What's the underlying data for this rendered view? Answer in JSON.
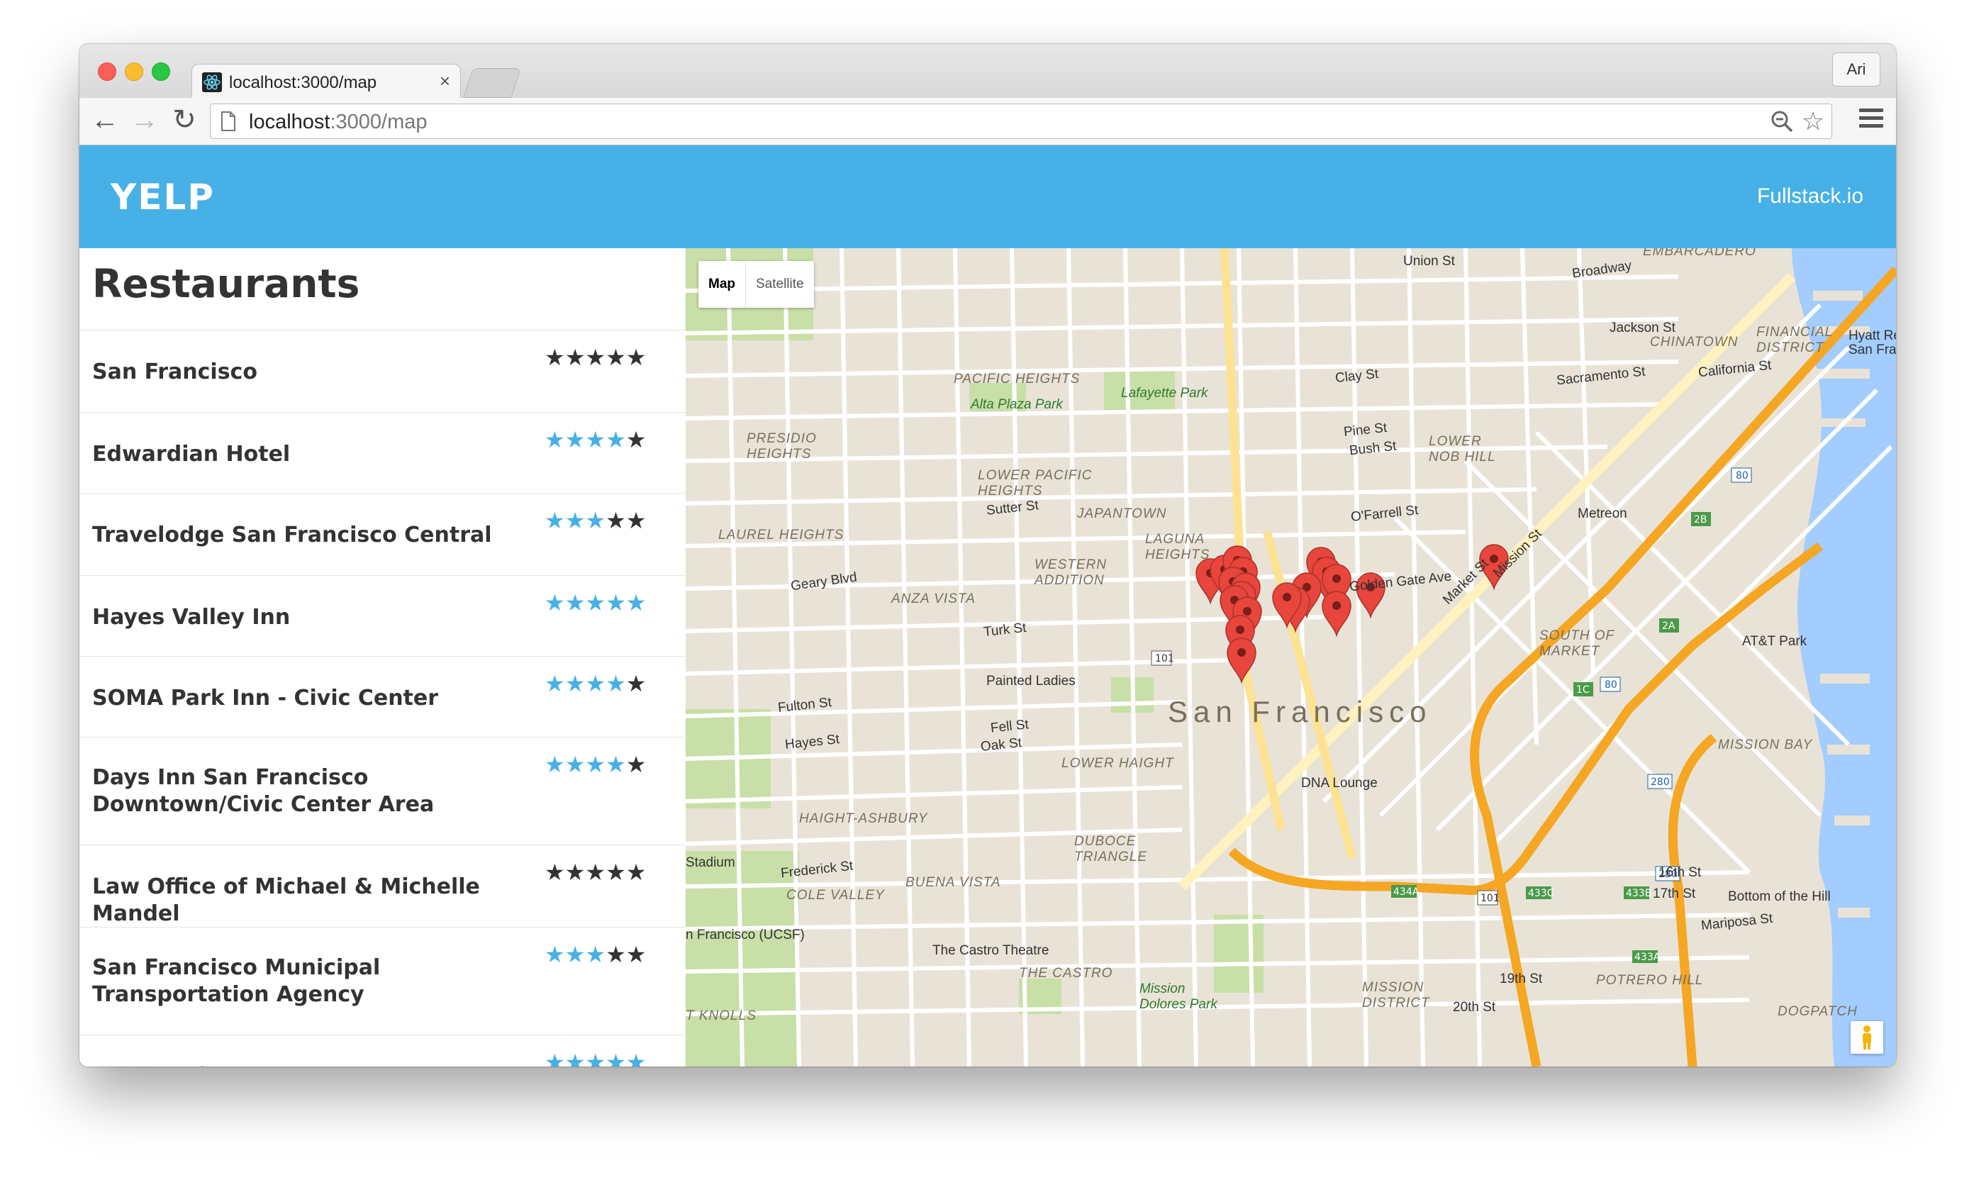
{
  "browser": {
    "tab_title": "localhost:3000/map",
    "tab_close": "×",
    "profile_label": "Ari",
    "url_host": "localhost",
    "url_path": ":3000/map",
    "back_glyph": "←",
    "forward_glyph": "→",
    "reload_glyph": "↻",
    "star_glyph": "☆"
  },
  "app": {
    "logo": "YELP",
    "brand_link": "Fullstack.io",
    "sidebar_title": "Restaurants"
  },
  "restaurants": [
    {
      "name": "San Francisco",
      "rating": 0
    },
    {
      "name": "Edwardian Hotel",
      "rating": 4
    },
    {
      "name": "Travelodge San Francisco Central",
      "rating": 3
    },
    {
      "name": "Hayes Valley Inn",
      "rating": 5
    },
    {
      "name": "SOMA Park Inn - Civic Center",
      "rating": 4
    },
    {
      "name": "Days Inn San Francisco Downtown/Civic Center Area",
      "rating": 4
    },
    {
      "name": "Law Office of Michael & Michelle Mandel",
      "rating": 0
    },
    {
      "name": "San Francisco Municipal Transportation Agency",
      "rating": 3
    },
    {
      "name": "Zuni Café",
      "rating": 5
    }
  ],
  "map": {
    "map_type_map": "Map",
    "map_type_satellite": "Satellite",
    "city_label": "San Francisco",
    "labels": {
      "union_st": "Union St",
      "jackson_st": "Jackson St",
      "chinatown": "CHINATOWN",
      "financial_district": "FINANCIAL DISTRICT",
      "hyatt": "Hyatt Regency San Francisco",
      "pacific_heights": "PACIFIC HEIGHTS",
      "alta_plaza": "Alta Plaza Park",
      "lafayette": "Lafayette Park",
      "presidio_heights": "PRESIDIO HEIGHTS",
      "lower_pacific": "LOWER PACIFIC HEIGHTS",
      "japantown": "JAPANTOWN",
      "laurel_heights": "LAUREL HEIGHTS",
      "western_addition": "WESTERN ADDITION",
      "laguna_heights": "LAGUNA HEIGHTS",
      "anza_vista": "ANZA VISTA",
      "lower_nob_hill": "LOWER NOB HILL",
      "metreon": "Metreon",
      "south_of_market": "SOUTH OF MARKET",
      "att_park": "AT&T Park",
      "painted_ladies": "Painted Ladies",
      "mission_bay": "MISSION BAY",
      "lower_haight": "LOWER HAIGHT",
      "haight_ashbury": "HAIGHT-ASHBURY",
      "duboce": "DUBOCE TRIANGLE",
      "dna_lounge": "DNA Lounge",
      "cole_valley": "COLE VALLEY",
      "buena_vista": "BUENA VISTA",
      "castro_theatre": "The Castro Theatre",
      "the_castro": "THE CASTRO",
      "mission_dolores": "Mission Dolores Park",
      "mission_district": "MISSION DISTRICT",
      "potrero_hill": "POTRERO HILL",
      "bottom_of_hill": "Bottom of the Hill",
      "dogpatch": "DOGPATCH",
      "ucsf": "n Francisco (UCSF)",
      "stadium": "Stadium",
      "geary_blvd": "Geary Blvd",
      "turk_st": "Turk St",
      "fell_st": "Fell St",
      "oak_st": "Oak St",
      "market_st": "Market St",
      "mission_st": "Mission St",
      "16th_st": "16th St",
      "17th_st": "17th St",
      "19th_st": "19th St",
      "20th_st": "20th St",
      "knolls": "T KNOLLS",
      "embarcadero": "EMBARCADERO",
      "broadway": "Broadway",
      "california_st": "California St",
      "sacramento_st": "Sacramento St",
      "clay_st": "Clay St",
      "pine_st": "Pine St",
      "bush_st": "Bush St",
      "sutter_st": "Sutter St",
      "ofarrell_st": "O'Farrell St",
      "golden_gate_ave": "Golden Gate Ave",
      "fulton_st": "Fulton St",
      "hayes_st": "Hayes St",
      "frederick_st": "Frederick St",
      "mariposa_st": "Mariposa St"
    },
    "colors": {
      "land": "#e8e3d6",
      "water": "#a3ccff",
      "park": "#c8dfa8",
      "highway": "#f5a623",
      "arterial": "#fde293",
      "road": "#ffffff",
      "marker": "#e8453c"
    }
  }
}
